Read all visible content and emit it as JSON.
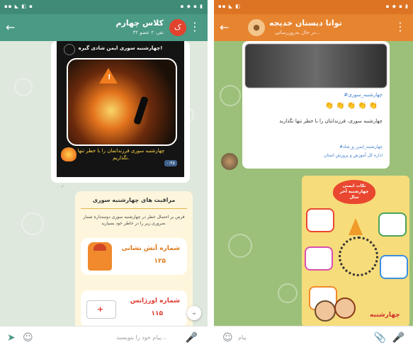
{
  "left_screen": {
    "chat_title": "کلاس چهارم",
    "chat_subtitle": "۳۲ نفر، ۲ عضو",
    "avatar_letter": "ک",
    "poster_title": "چهارشنبه سوری ایمن شادی گیره!",
    "poster_caption": "چهارشنبه سوری فرزندانمان را با خطر تنها نگذاریم.",
    "video_badge": "۰:۴۵",
    "card_heading": "مراقبت های چهارشنبه سوری",
    "card_intro": "فرض بر احتمال خطر در چهارشنبه سوری دوستداره شمار ضروری زیر را در خاطر خود بسپارید.",
    "fire_label": "شماره آتش نشانی",
    "fire_number": "۱۲۵",
    "ambulance_label": "شماره اورژانس",
    "ambulance_number": "۱۱۵",
    "input_placeholder": "پیام خود را بنویسید..."
  },
  "right_screen": {
    "chat_title": "توانا دبستان خدیجه",
    "chat_subtitle": "در حال به‌روزرسانی...",
    "hashtag": "#چهارشنبه_سوری",
    "emoji_row": "👏👏👏👏👏",
    "warning_text": "چهارشنبه سوری، فرزندانتان را با خطر تنها نگذارید",
    "hashtags_footer": "#چهارشنبه_ایمن_و_شاد",
    "org_footer": "اداره کل آموزش و پرورش استان",
    "poster_heading": "نکات ایمنی چهارشنبه آخر سال",
    "poster_brand": "چهارشنبه",
    "input_placeholder": "پیام"
  },
  "colors": {
    "left_bar": "#4a9a85",
    "right_bar": "#e7842f",
    "left_avatar": "#e2432f",
    "right_avatar": "#f3c58b",
    "poster_yellow": "#f6dc7a"
  },
  "icons": {
    "back": "arrow-right-icon",
    "menu": "more-vertical-icon",
    "emoji": "emoji-icon",
    "attach": "attach-icon",
    "mic": "microphone-icon"
  }
}
